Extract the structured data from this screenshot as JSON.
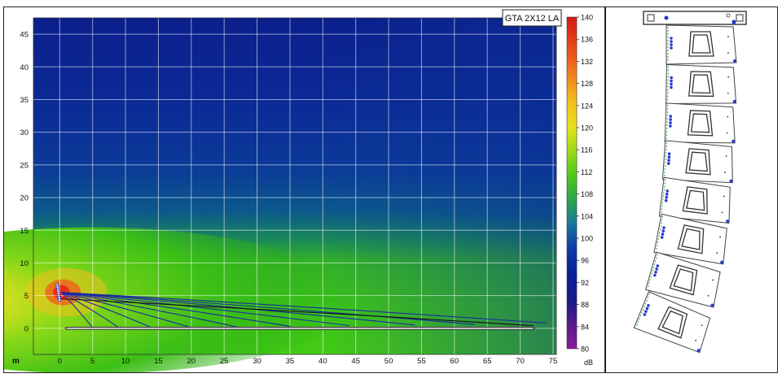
{
  "chart_data": {
    "type": "heatmap",
    "title": "GTA 2X12 LA",
    "x_unit_label": "m",
    "x_ticks": [
      "0",
      "5",
      "10",
      "15",
      "20",
      "25",
      "30",
      "35",
      "40",
      "45",
      "50",
      "55",
      "60",
      "65",
      "70",
      "75"
    ],
    "y_ticks": [
      "0",
      "5",
      "10",
      "15",
      "20",
      "25",
      "30",
      "35",
      "40",
      "45"
    ],
    "xlim": [
      -4,
      75.5
    ],
    "ylim": [
      -4,
      47.5
    ],
    "grid": true,
    "colorbar": {
      "unit": "dB",
      "min": 80,
      "max": 140,
      "ticks": [
        "140",
        "136",
        "132",
        "128",
        "124",
        "120",
        "116",
        "112",
        "108",
        "104",
        "100",
        "96",
        "92",
        "88",
        "84",
        "80"
      ]
    },
    "colors": {
      "high": "#d81b1b",
      "mid": "#3cc016",
      "low": "#0a2490",
      "grid": "#ffffff"
    },
    "source_position": [
      0,
      5.5
    ],
    "audience_plane": {
      "y": 0,
      "x": [
        1,
        72
      ]
    },
    "rays": [
      {
        "end": [
          74,
          0.8
        ],
        "color": "#1a2aa0"
      },
      {
        "end": [
          63,
          0.6
        ],
        "color": "#1a2aa0"
      },
      {
        "end": [
          54,
          0.5
        ],
        "color": "#1a2aa0"
      },
      {
        "end": [
          44,
          0.4
        ],
        "color": "#1a2aa0"
      },
      {
        "end": [
          35,
          0.3
        ],
        "color": "#1a2aa0"
      },
      {
        "end": [
          27,
          0.2
        ],
        "color": "#1a2aa0"
      },
      {
        "end": [
          20,
          0.1
        ],
        "color": "#1a2aa0"
      },
      {
        "end": [
          14,
          0.1
        ],
        "color": "#1a2aa0"
      },
      {
        "end": [
          9,
          0.1
        ],
        "color": "#1a2aa0"
      },
      {
        "end": [
          5,
          0.1
        ],
        "color": "#1a2aa0"
      },
      {
        "end": [
          72,
          0.4
        ],
        "color": "#111111"
      }
    ]
  },
  "array_view": {
    "cabinet_count": 8
  }
}
